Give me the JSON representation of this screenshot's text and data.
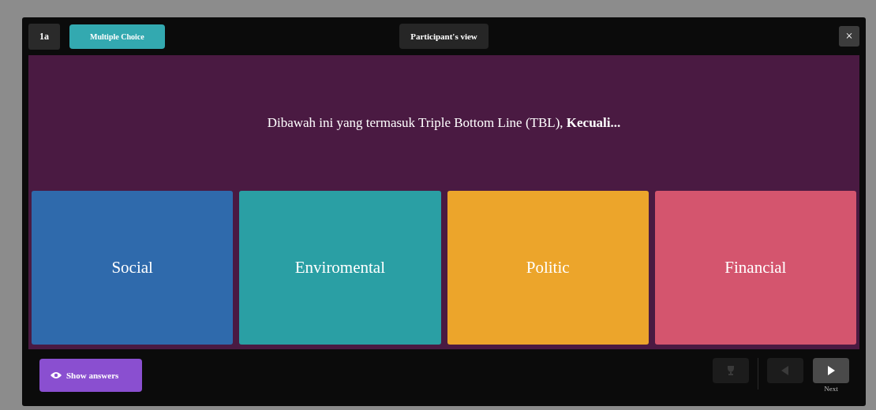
{
  "header": {
    "question_number": "1a",
    "question_type": "Multiple Choice",
    "view_button": "Participant's view",
    "close": "×"
  },
  "question": "Dibawah ini yang termasuk Triple Bottom Line (TBL), **Kecuali...**",
  "answers": [
    {
      "text": "Social",
      "color": "#2f6aac"
    },
    {
      "text": "Enviromental",
      "color": "#2a9fa4"
    },
    {
      "text": "Politic",
      "color": "#eca52b"
    },
    {
      "text": "Financial",
      "color": "#d4556e"
    }
  ],
  "footer": {
    "show_answers": "Show answers",
    "nav": [
      {
        "kind": "trophy",
        "disabled": true
      },
      {
        "kind": "previous",
        "disabled": true
      },
      {
        "kind": "next",
        "disabled": false,
        "label": "Next"
      }
    ]
  }
}
